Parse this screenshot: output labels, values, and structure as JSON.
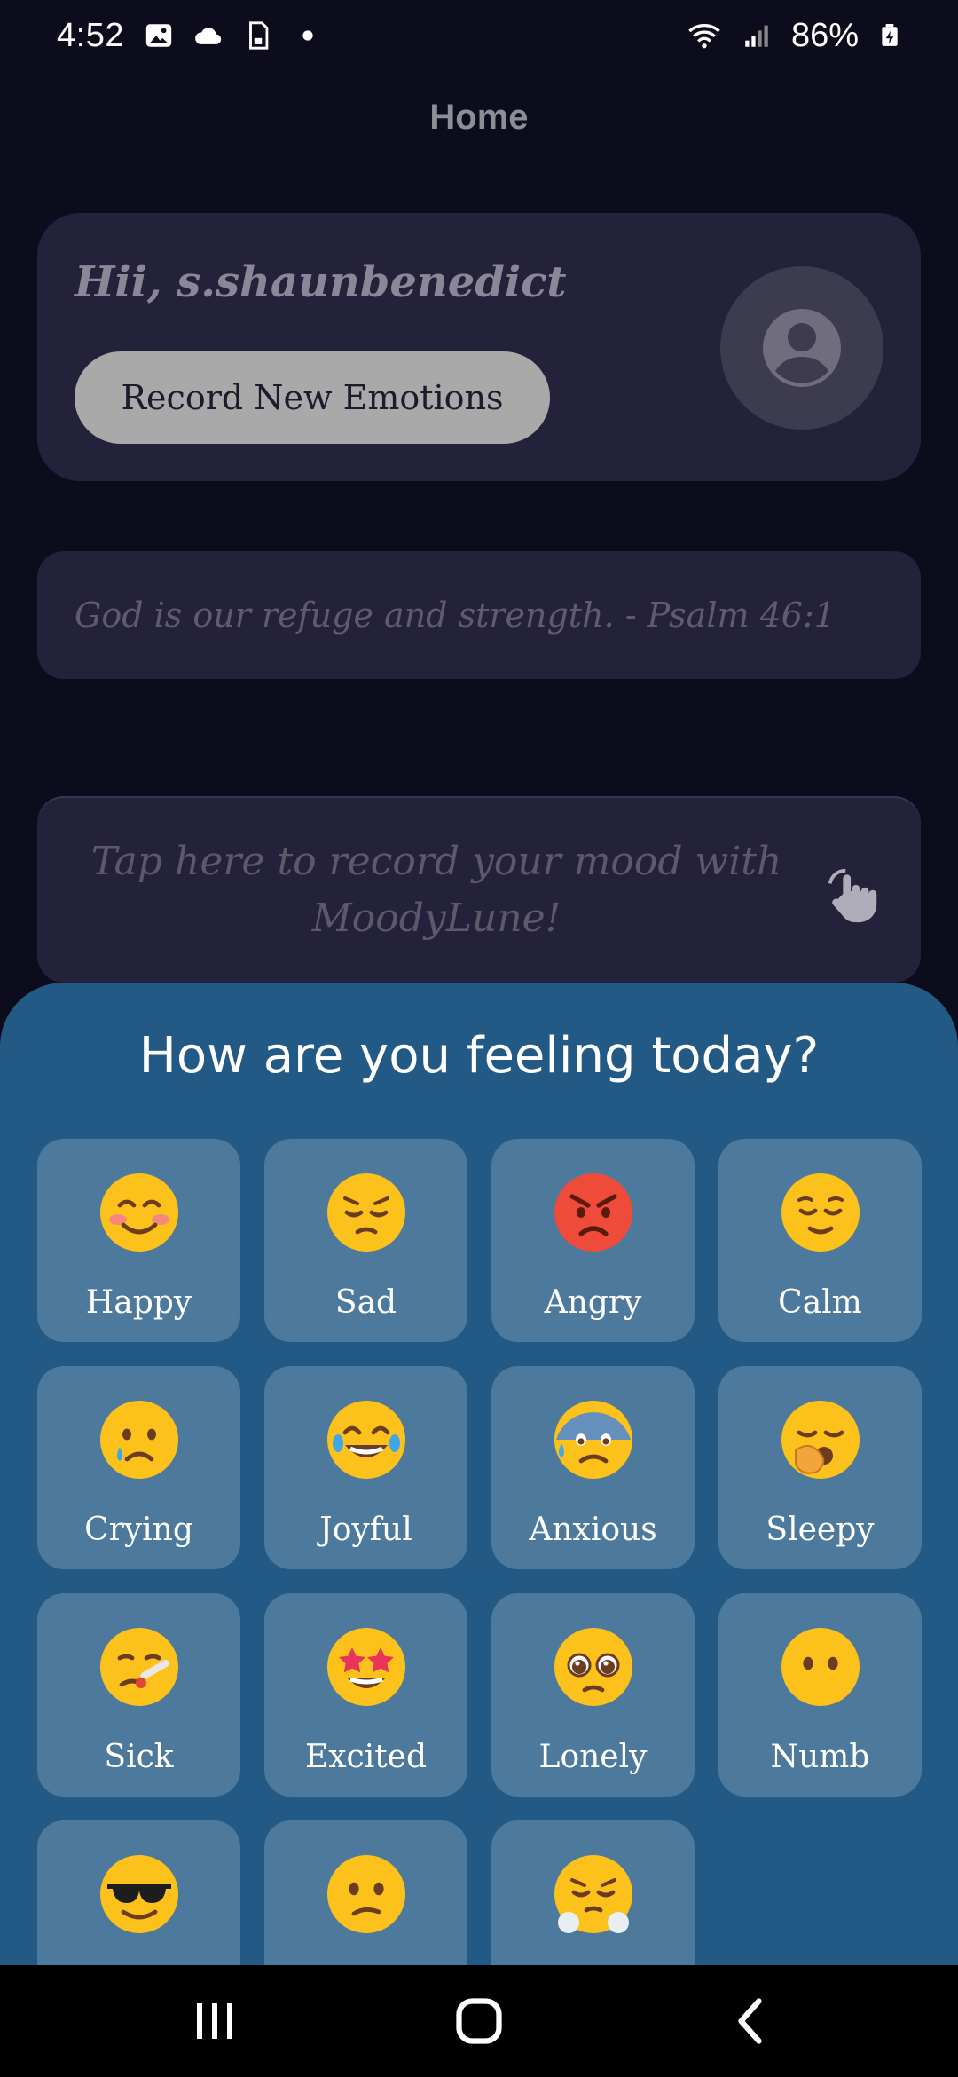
{
  "status_bar": {
    "time": "4:52",
    "battery": "86%",
    "icons": [
      "gallery-icon",
      "cloud-icon",
      "sim-icon",
      "dot-icon",
      "wifi-icon",
      "signal-icon",
      "battery-icon"
    ]
  },
  "header": {
    "title": "Home"
  },
  "greeting": {
    "text": "Hii, s.shaunbenedict",
    "record_button": "Record New Emotions",
    "avatar_icon": "user-avatar-icon"
  },
  "quote": {
    "text": "God is our refuge and strength. - Psalm 46:1"
  },
  "tap_card": {
    "text": "Tap here to record your mood with MoodyLune!",
    "icon": "tap-hand-icon"
  },
  "sheet": {
    "title": "How are you feeling today?",
    "moods": [
      {
        "label": "Happy",
        "icon": "smiling-blush-emoji"
      },
      {
        "label": "Sad",
        "icon": "pensive-emoji"
      },
      {
        "label": "Angry",
        "icon": "angry-emoji"
      },
      {
        "label": "Calm",
        "icon": "relieved-emoji"
      },
      {
        "label": "Crying",
        "icon": "crying-emoji"
      },
      {
        "label": "Joyful",
        "icon": "tears-of-joy-emoji"
      },
      {
        "label": "Anxious",
        "icon": "anxious-sweat-emoji"
      },
      {
        "label": "Sleepy",
        "icon": "yawning-emoji"
      },
      {
        "label": "Sick",
        "icon": "thermometer-emoji"
      },
      {
        "label": "Excited",
        "icon": "star-struck-emoji"
      },
      {
        "label": "Lonely",
        "icon": "pleading-emoji"
      },
      {
        "label": "Numb",
        "icon": "no-mouth-emoji"
      },
      {
        "label": "",
        "icon": "sunglasses-emoji"
      },
      {
        "label": "",
        "icon": "confused-emoji"
      },
      {
        "label": "",
        "icon": "triumph-emoji"
      }
    ]
  },
  "colors": {
    "background": "#0d0c1d",
    "card": "#24223a",
    "sheet": "#235a85",
    "tile": "#4d7a9c"
  },
  "nav_bar": {
    "icons": [
      "recents-icon",
      "home-icon",
      "back-icon"
    ]
  }
}
